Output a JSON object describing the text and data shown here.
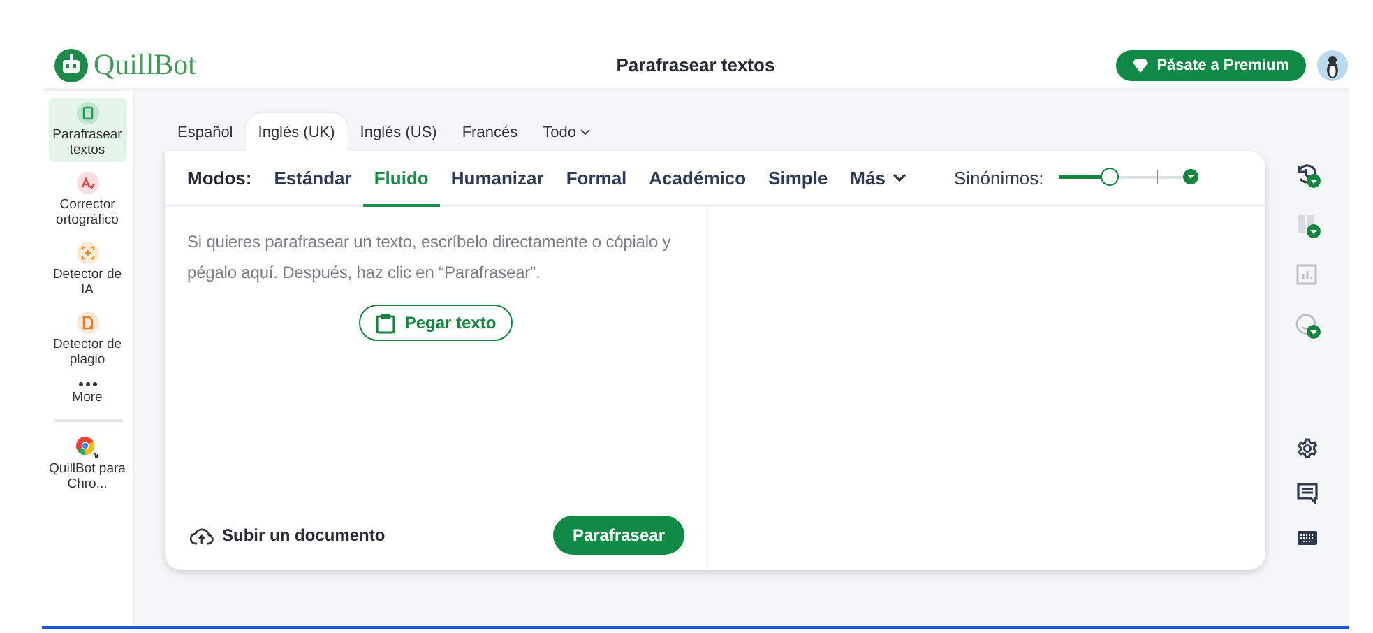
{
  "header": {
    "logo": "QuillBot",
    "title": "Parafrasear textos",
    "premium_button": "Pásate a Premium"
  },
  "sidebar": {
    "items": [
      {
        "kind": "paraphrase",
        "label": "Parafrasear textos",
        "selected": true,
        "color": "#1e9b54"
      },
      {
        "kind": "grammar",
        "label": "Corrector ortográfico",
        "selected": false,
        "color": "#e5484d"
      },
      {
        "kind": "detector",
        "label": "Detector de IA",
        "selected": false,
        "color": "#f08c1a"
      },
      {
        "kind": "plagiarism",
        "label": "Detector de plagio",
        "selected": false,
        "color": "#f07a1a"
      }
    ],
    "more": "More",
    "extension": "QuillBot para Chro..."
  },
  "language_tabs": [
    {
      "label": "Español",
      "selected": false
    },
    {
      "label": "Inglés (UK)",
      "selected": true
    },
    {
      "label": "Inglés (US)",
      "selected": false
    },
    {
      "label": "Francés",
      "selected": false
    }
  ],
  "all_languages": "Todo",
  "modes": {
    "label": "Modos:",
    "items": [
      {
        "label": "Estándar",
        "selected": false
      },
      {
        "label": "Fluido",
        "selected": true
      },
      {
        "label": "Humanizar",
        "selected": false
      },
      {
        "label": "Formal",
        "selected": false
      },
      {
        "label": "Académico",
        "selected": false
      },
      {
        "label": "Simple",
        "selected": false
      }
    ],
    "more": "Más"
  },
  "synonyms": {
    "label": "Sinónimos:",
    "level": 0.36
  },
  "editor": {
    "placeholder": "Si quieres parafrasear un texto, escríbelo directamente o cópialo y pégalo aquí. Después, haz clic en “Parafrasear”.",
    "paste_button": "Pegar texto",
    "upload": "Subir un documento",
    "submit_button": "Parafrasear"
  },
  "tools": [
    {
      "kind": "history",
      "premium": true,
      "disabled": false
    },
    {
      "kind": "compare",
      "premium": true,
      "disabled": true
    },
    {
      "kind": "stats",
      "premium": false,
      "disabled": true
    },
    {
      "kind": "tone",
      "premium": true,
      "disabled": true
    }
  ],
  "bottom_tools": [
    {
      "kind": "settings"
    },
    {
      "kind": "feedback"
    },
    {
      "kind": "keyboard"
    }
  ]
}
